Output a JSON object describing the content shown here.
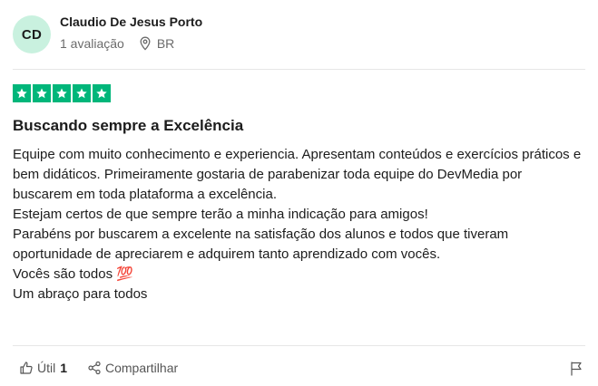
{
  "reviewer": {
    "initials": "CD",
    "name": "Claudio De Jesus Porto",
    "reviews_count": "1 avaliação",
    "country": "BR",
    "avatar_color": "#c9f1df"
  },
  "review": {
    "rating": 5,
    "star_color": "#00b67a",
    "title": "Buscando sempre a Excelência",
    "lines": [
      "Equipe com muito conhecimento e experiencia. Apresentam conteúdos e exercícios práticos e bem didáticos. Primeiramente gostaria de parabenizar toda equipe do DevMedia por buscarem em toda plataforma a excelência.",
      "Estejam certos de que sempre terão a minha indicação para amigos!",
      "Parabéns por buscarem a excelente na satisfação dos alunos e todos que tiveram oportunidade de apreciarem e adquirem tanto aprendizado com vocês.",
      "Vocês são todos 💯",
      "Um abraço para todos"
    ]
  },
  "footer": {
    "useful_label": "Útil",
    "useful_count": "1",
    "share_label": "Compartilhar",
    "icons": [
      "thumbs-up-icon",
      "share-icon",
      "flag-icon"
    ]
  }
}
